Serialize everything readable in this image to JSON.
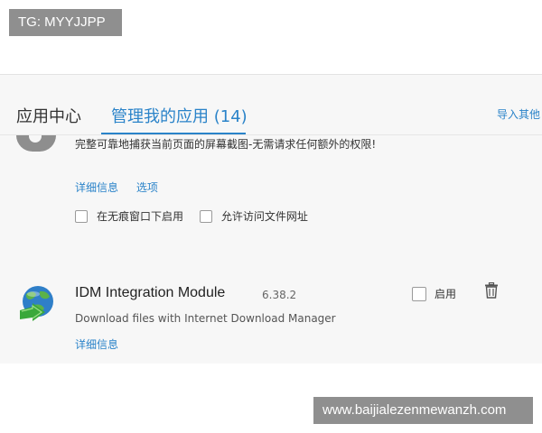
{
  "watermarks": {
    "top": "TG: MYYJJPP",
    "bottom": "www.baijialezenmewanzh.com"
  },
  "tabs": {
    "app_center": "应用中心",
    "manage_label": "管理我的应用",
    "manage_count": "(14)",
    "import_link": "导入其他"
  },
  "extension_1": {
    "icon": "camera-icon",
    "description": "完整可靠地捕获当前页面的屏幕截图-无需请求任何额外的权限!",
    "details_link": "详细信息",
    "options_link": "选项",
    "incognito_label": "在无痕窗口下启用",
    "file_access_label": "允许访问文件网址"
  },
  "extension_2": {
    "icon": "idm-globe-icon",
    "title": "IDM Integration Module",
    "version": "6.38.2",
    "description": "Download files with Internet Download Manager",
    "details_link": "详细信息",
    "enable_label": "启用",
    "delete_icon": "trash-icon"
  },
  "colors": {
    "accent": "#2a83c9",
    "panel_bg": "#f7f7f7",
    "watermark_bg": "#8f8f8f"
  }
}
